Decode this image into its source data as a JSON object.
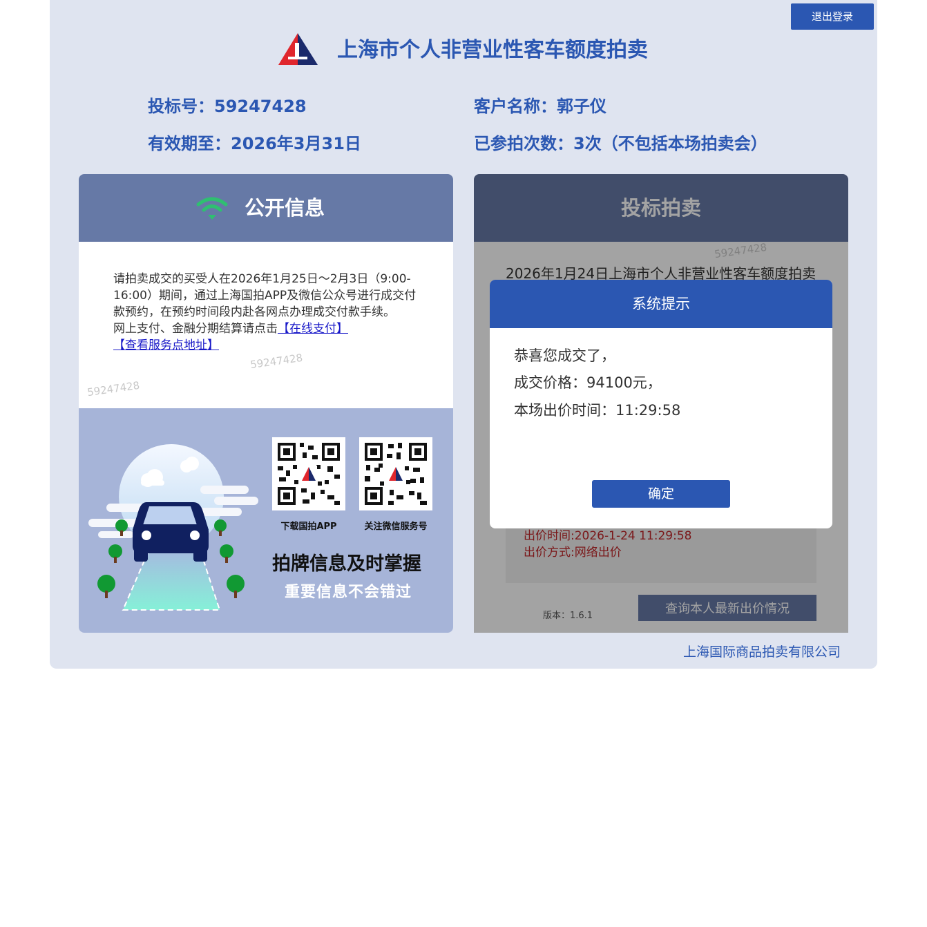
{
  "header": {
    "logout_label": "退出登录",
    "title": "上海市个人非营业性客车额度拍卖"
  },
  "user_info": {
    "bid_number": "投标号：59247428",
    "customer_name": "客户名称：郭子仪",
    "valid_until": "有效期至：2026年3月31日",
    "participation_count": "已参拍次数：3次（不包括本场拍卖会）"
  },
  "public_info": {
    "title": "公开信息",
    "notice_text": "请拍卖成交的买受人在2026年1月25日～2月3日（9:00-16:00）期间，通过上海国拍APP及微信公众号进行成交付款预约，在预约时间段内赴各网点办理成交付款手续。",
    "payment_text": "网上支付、金融分期结算请点击",
    "online_pay_link": "【在线支付】",
    "service_point_link": "【查看服务点地址】",
    "banner": {
      "qr_app_caption": "下载国拍APP",
      "qr_wechat_caption": "关注微信服务号",
      "slogan_main": "拍牌信息及时掌握",
      "slogan_sub": "重要信息不会错过"
    }
  },
  "bid_auction": {
    "title": "投标拍卖",
    "auction_name": "2026年1月24日上海市个人非营业性客车额度拍卖",
    "bid_time": "出价时间:2026-1-24 11:29:58",
    "bid_method": "出价方式:网络出价",
    "query_button": "查询本人最新出价情况",
    "version": "版本：1.6.1"
  },
  "watermark": "59247428",
  "modal": {
    "title": "系统提示",
    "line1": "恭喜您成交了，",
    "line2": "成交价格：94100元，",
    "line3": "本场出价时间：11:29:58",
    "ok_label": "确定"
  },
  "footer": {
    "company": "上海国际商品拍卖有限公司"
  },
  "colors": {
    "brand_blue": "#2b57b2",
    "panel_header": "#6679a6",
    "frame_background": "#dfe4f0",
    "alert_red": "#c0282b",
    "wifi_green": "#2fbf71"
  }
}
